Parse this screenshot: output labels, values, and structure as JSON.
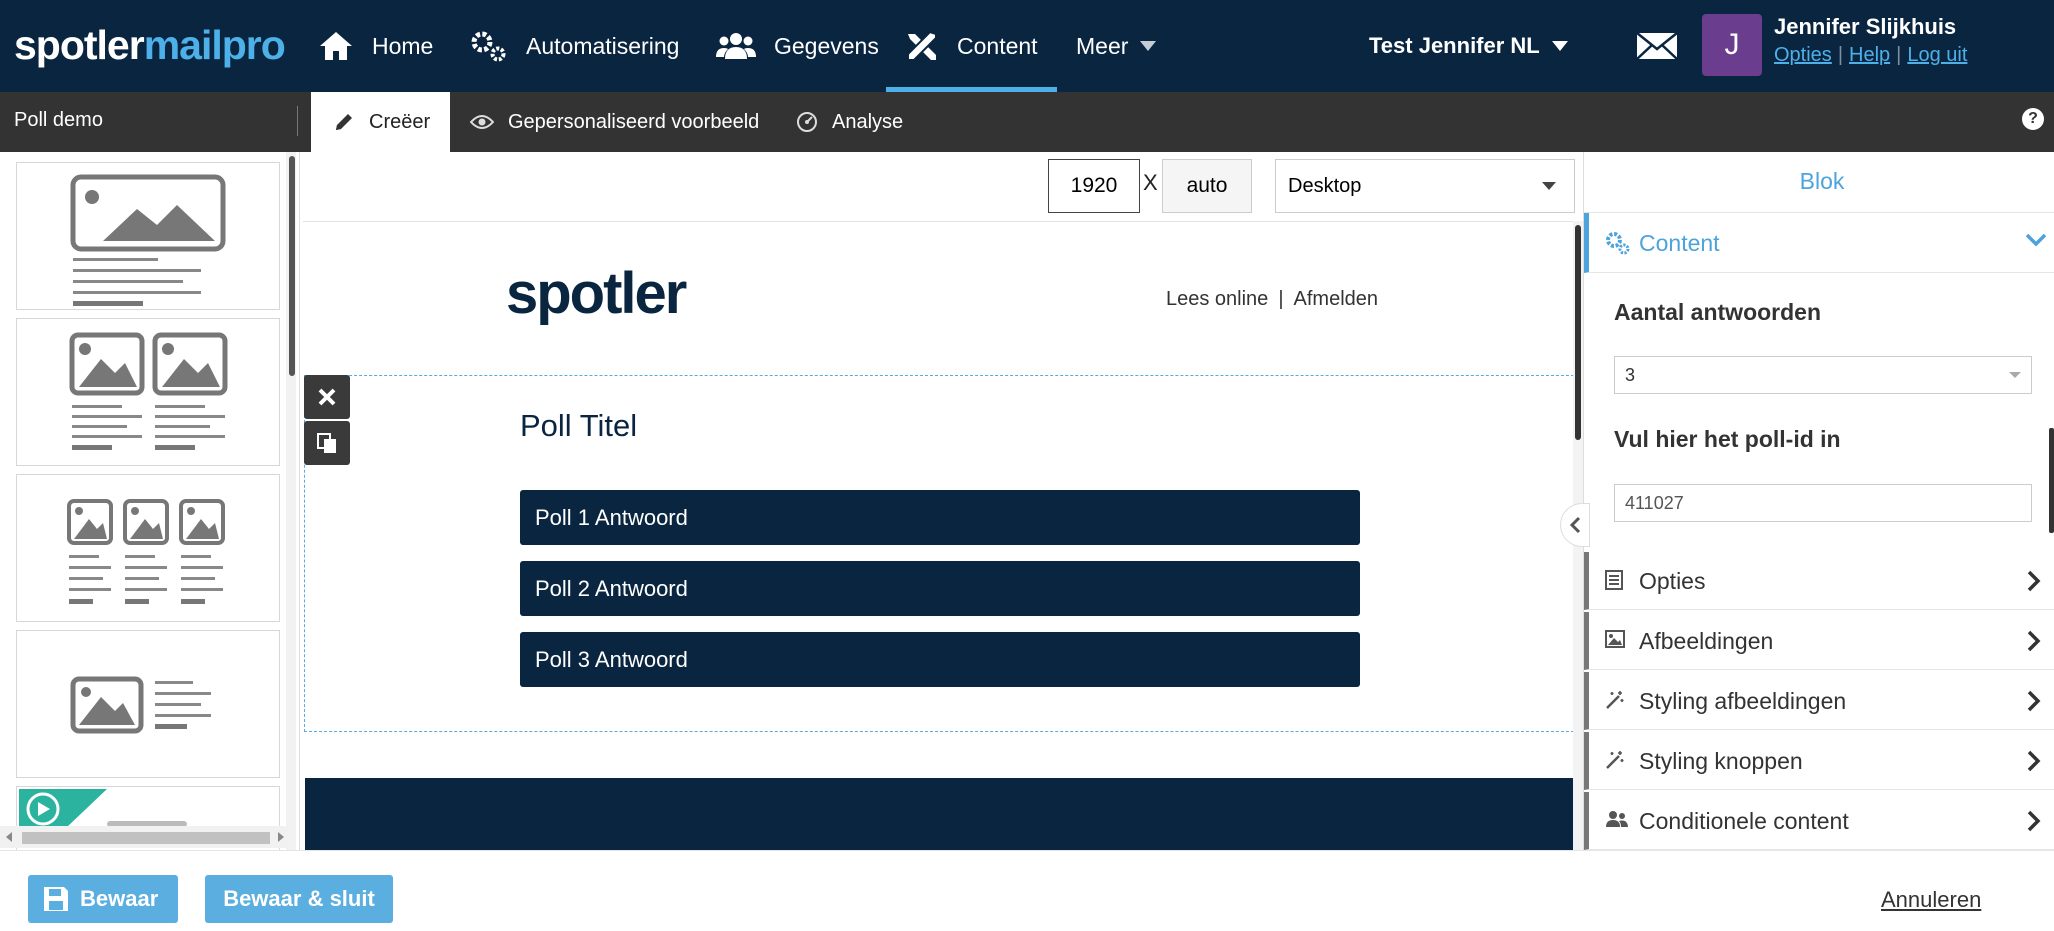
{
  "brand": {
    "part1": "spotler",
    "part2": "mailpro"
  },
  "nav": {
    "home": "Home",
    "automation": "Automatisering",
    "data": "Gegevens",
    "content": "Content",
    "more": "Meer"
  },
  "account": {
    "name": "Test Jennifer NL"
  },
  "user": {
    "initial": "J",
    "name": "Jennifer Slijkhuis",
    "options": "Opties",
    "help": "Help",
    "logout": "Log uit",
    "sep": "|"
  },
  "toolbar": {
    "doc_title": "Poll demo",
    "tab_create": "Creëer",
    "tab_preview": "Gepersonaliseerd voorbeeld",
    "tab_analysis": "Analyse",
    "help": "?"
  },
  "canvas_controls": {
    "width": "1920",
    "x": "X",
    "height": "auto",
    "device": "Desktop"
  },
  "email": {
    "logo": "spotler",
    "read_online": "Lees online",
    "separator": "|",
    "unsubscribe": "Afmelden",
    "poll_title": "Poll Titel",
    "answers": [
      "Poll 1 Antwoord",
      "Poll 2 Antwoord",
      "Poll 3 Antwoord"
    ]
  },
  "rightpanel": {
    "tab": "Blok",
    "section_content": "Content",
    "answers_label": "Aantal antwoorden",
    "answers_value": "3",
    "pollid_label": "Vul hier het poll-id in",
    "pollid_value": "411027",
    "sections": [
      "Opties",
      "Afbeeldingen",
      "Styling afbeeldingen",
      "Styling knoppen",
      "Conditionele content"
    ]
  },
  "bottom": {
    "save": "Bewaar",
    "save_close": "Bewaar & sluit",
    "cancel": "Annuleren"
  },
  "colors": {
    "navy": "#0a2540",
    "accent": "#4db0e8",
    "button": "#5aafe0",
    "avatar": "#6b3d8f"
  }
}
